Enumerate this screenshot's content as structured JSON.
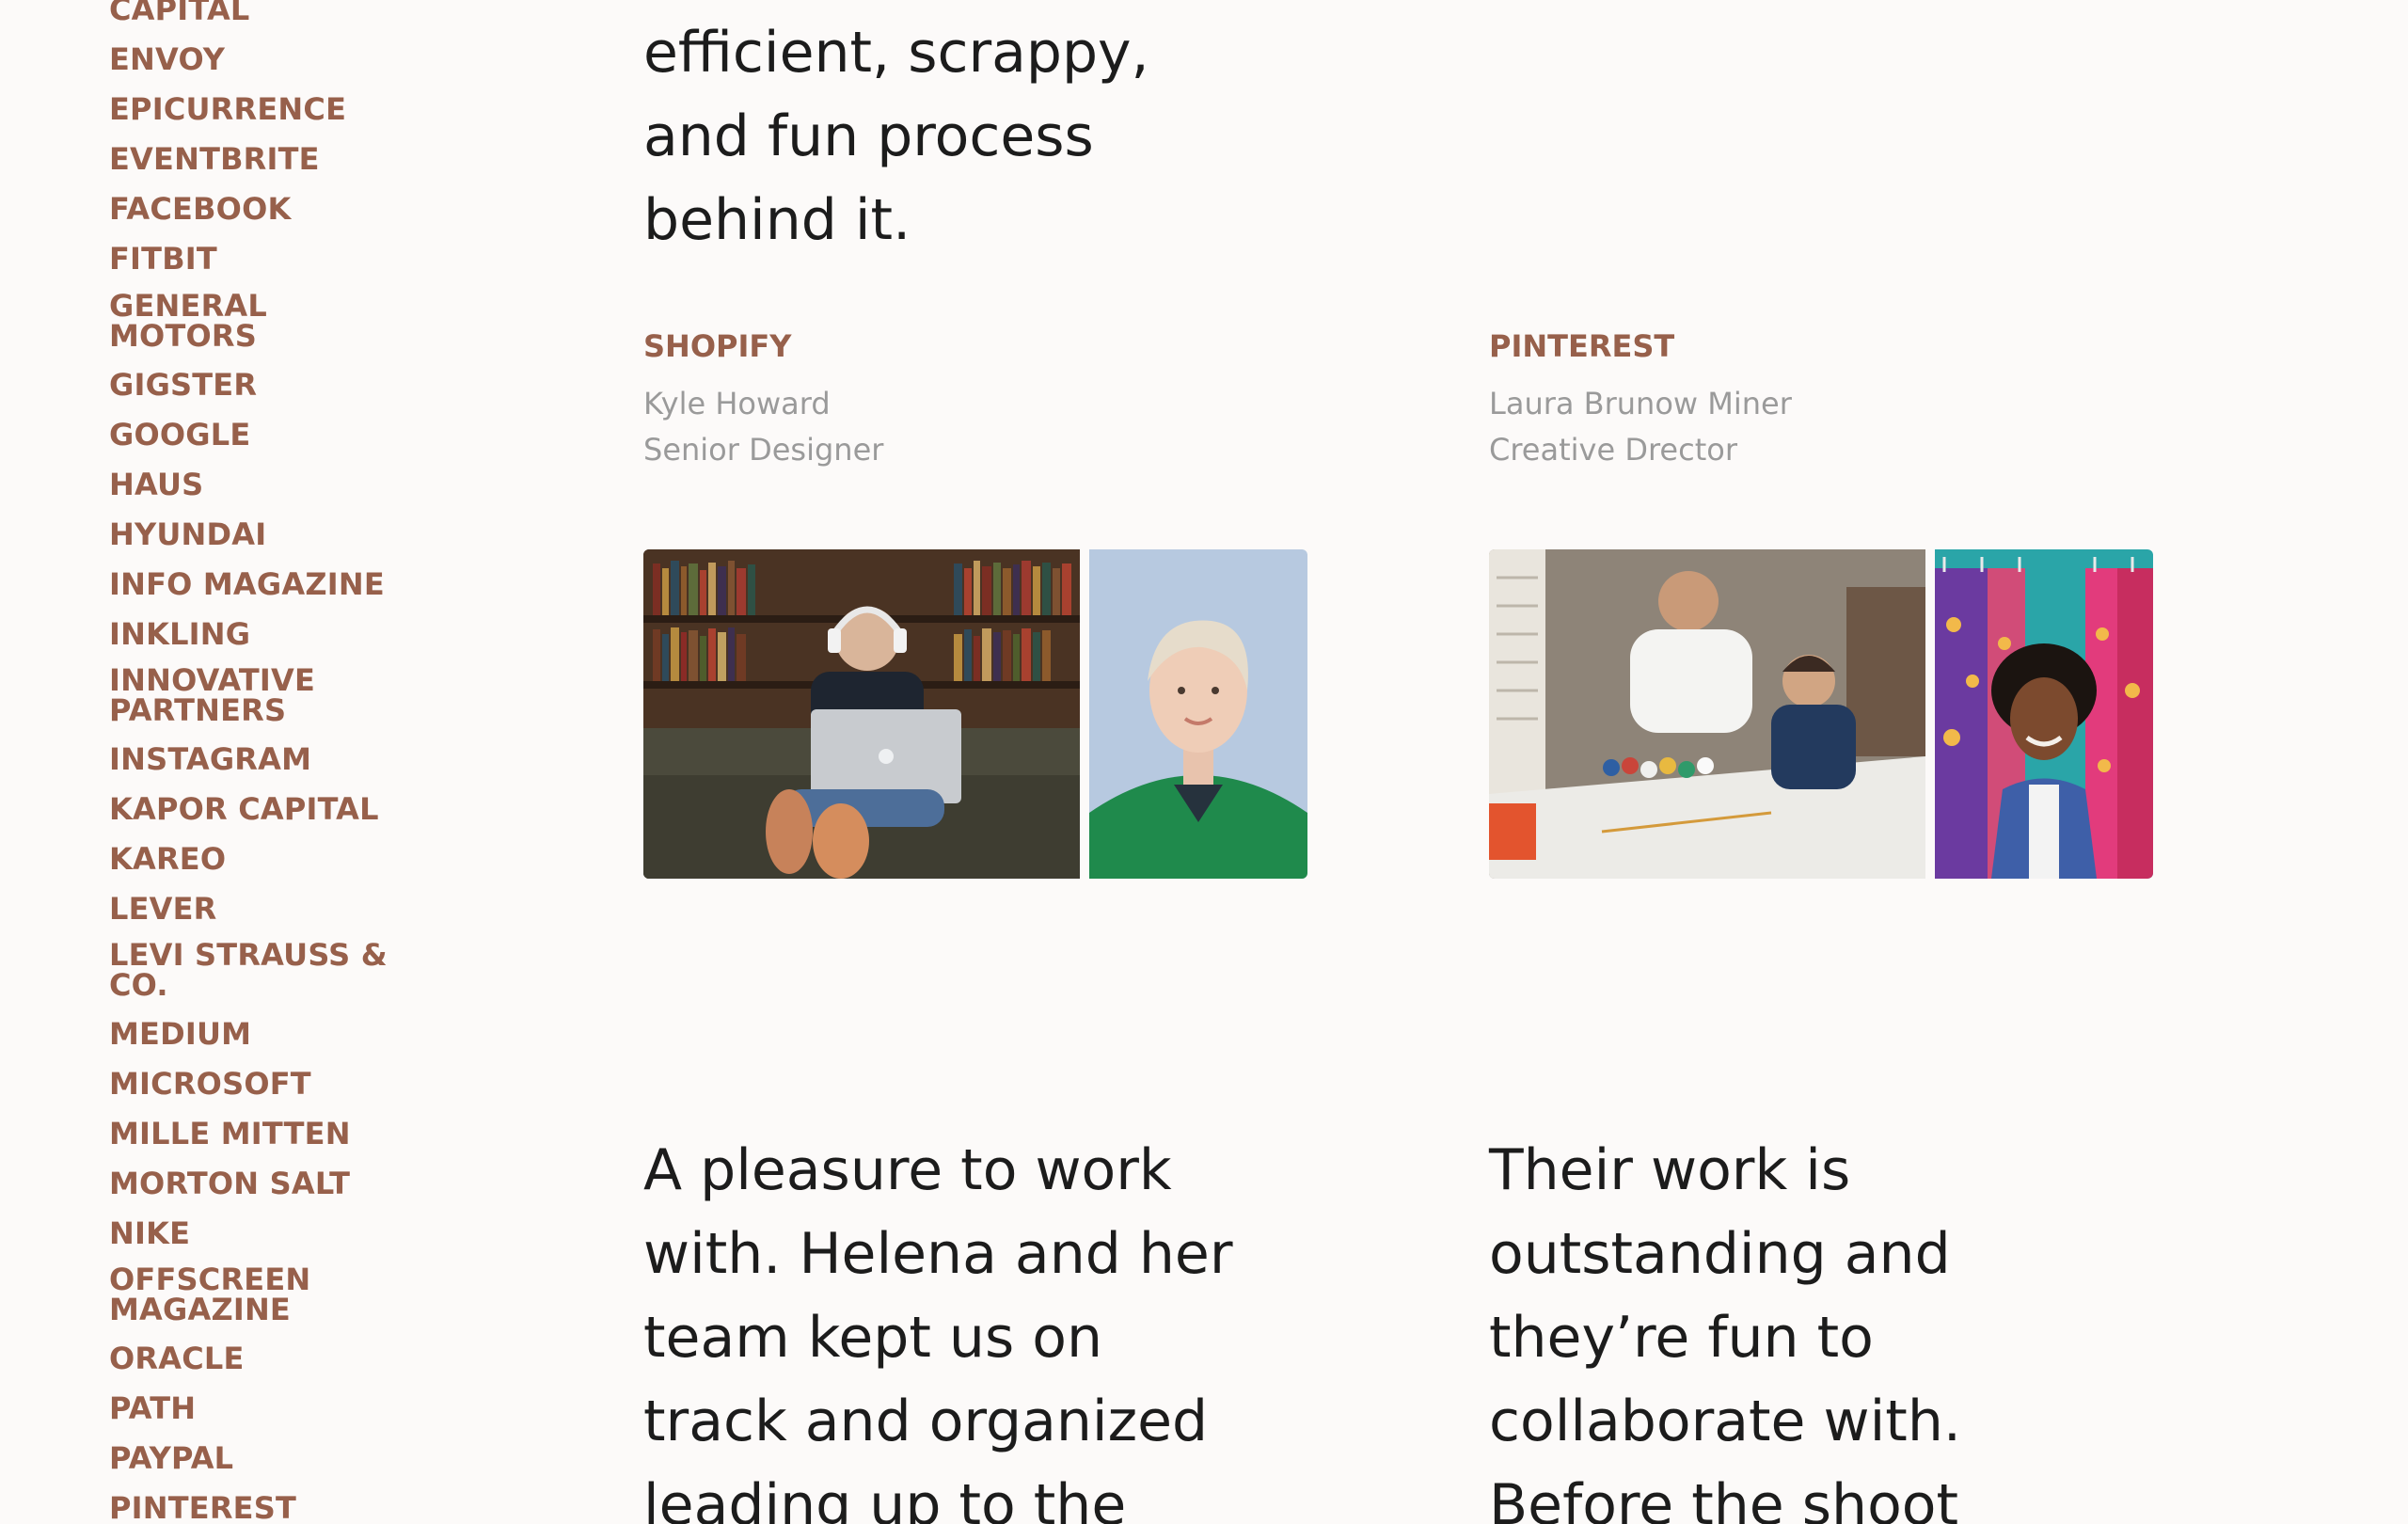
{
  "sidebar": {
    "clients": [
      {
        "label": "CAPITAL"
      },
      {
        "label": "ENVOY"
      },
      {
        "label": "EPICURRENCE"
      },
      {
        "label": "EVENTBRITE"
      },
      {
        "label": "FACEBOOK"
      },
      {
        "label": "FITBIT"
      },
      {
        "label": "GENERAL MOTORS"
      },
      {
        "label": "GIGSTER"
      },
      {
        "label": "GOOGLE"
      },
      {
        "label": "HAUS"
      },
      {
        "label": "HYUNDAI"
      },
      {
        "label": "INFO MAGAZINE"
      },
      {
        "label": "INKLING"
      },
      {
        "label": "INNOVATIVE PARTNERS"
      },
      {
        "label": "INSTAGRAM"
      },
      {
        "label": "KAPOR CAPITAL"
      },
      {
        "label": "KAREO"
      },
      {
        "label": "LEVER"
      },
      {
        "label": "LEVI STRAUSS & CO."
      },
      {
        "label": "MEDIUM"
      },
      {
        "label": "MICROSOFT"
      },
      {
        "label": "MILLE MITTEN"
      },
      {
        "label": "MORTON SALT"
      },
      {
        "label": "NIKE"
      },
      {
        "label": "OFFSCREEN MAGAZINE"
      },
      {
        "label": "ORACLE"
      },
      {
        "label": "PATH"
      },
      {
        "label": "PAYPAL"
      },
      {
        "label": "PINTEREST"
      }
    ]
  },
  "intro": {
    "lines": [
      "efficient, scrappy,",
      "and fun process",
      "behind it."
    ]
  },
  "testimonials": [
    {
      "company": "SHOPIFY",
      "name": "Kyle Howard",
      "role": "Senior Designer",
      "photos": [
        "man-with-laptop-photo",
        "woman-green-sweater-photo"
      ],
      "quote_lines": [
        "A pleasure to work",
        "with. Helena and her",
        "team kept us on",
        "track and organized",
        "leading up to the"
      ]
    },
    {
      "company": "PINTEREST",
      "name": "Laura Brunow Miner",
      "role": "Creative Drector",
      "photos": [
        "father-son-painting-photo",
        "woman-fabrics-photo"
      ],
      "quote_lines": [
        "Their work is",
        "outstanding and",
        "they’re fun to",
        "collaborate with.",
        "Before the shoot"
      ]
    }
  ]
}
